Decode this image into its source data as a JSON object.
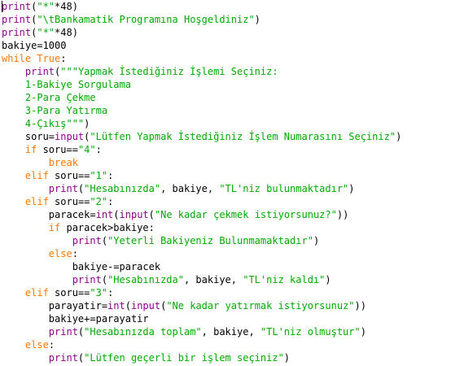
{
  "editor": {
    "colors": {
      "background": "#ffffff",
      "keyword": "#ff7700",
      "builtin": "#900090",
      "string": "#00aa00",
      "text": "#000000"
    },
    "lines": [
      [
        [
          "bi",
          "print"
        ],
        [
          "t",
          "("
        ],
        [
          "s",
          "\"*\""
        ],
        [
          "t",
          "*48)"
        ]
      ],
      [
        [
          "bi",
          "print"
        ],
        [
          "t",
          "("
        ],
        [
          "s",
          "\"\\tBankamatik Programına Hoşgeldiniz\""
        ],
        [
          "t",
          ")"
        ]
      ],
      [
        [
          "bi",
          "print"
        ],
        [
          "t",
          "("
        ],
        [
          "s",
          "\"*\""
        ],
        [
          "t",
          "*48)"
        ]
      ],
      [
        [
          "t",
          "bakiye=1000"
        ]
      ],
      [
        [
          "kw",
          "while"
        ],
        [
          "t",
          " "
        ],
        [
          "kw",
          "True"
        ],
        [
          "t",
          ":"
        ]
      ],
      [
        [
          "t",
          "    "
        ],
        [
          "bi",
          "print"
        ],
        [
          "t",
          "("
        ],
        [
          "s",
          "\"\"\"Yapmak İstediğiniz İşlemi Seçiniz:"
        ]
      ],
      [
        [
          "s",
          "    1-Bakiye Sorgulama"
        ]
      ],
      [
        [
          "s",
          "    2-Para Çekme"
        ]
      ],
      [
        [
          "s",
          "    3-Para Yatırma"
        ]
      ],
      [
        [
          "s",
          "    4-Çıkış\"\"\""
        ],
        [
          "t",
          ")"
        ]
      ],
      [
        [
          "t",
          "    soru="
        ],
        [
          "bi",
          "input"
        ],
        [
          "t",
          "("
        ],
        [
          "s",
          "\"Lütfen Yapmak İstediğiniz İşlem Numarasını Seçiniz\""
        ],
        [
          "t",
          ")"
        ]
      ],
      [
        [
          "t",
          "    "
        ],
        [
          "kw",
          "if"
        ],
        [
          "t",
          " soru=="
        ],
        [
          "s",
          "\"4\""
        ],
        [
          "t",
          ":"
        ]
      ],
      [
        [
          "t",
          "        "
        ],
        [
          "kw",
          "break"
        ]
      ],
      [
        [
          "t",
          "    "
        ],
        [
          "kw",
          "elif"
        ],
        [
          "t",
          " soru=="
        ],
        [
          "s",
          "\"1\""
        ],
        [
          "t",
          ":"
        ]
      ],
      [
        [
          "t",
          "        "
        ],
        [
          "bi",
          "print"
        ],
        [
          "t",
          "("
        ],
        [
          "s",
          "\"Hesabınızda\""
        ],
        [
          "t",
          ", bakiye, "
        ],
        [
          "s",
          "\"TL'niz bulunmaktadır\""
        ],
        [
          "t",
          ")"
        ]
      ],
      [
        [
          "t",
          "    "
        ],
        [
          "kw",
          "elif"
        ],
        [
          "t",
          " soru=="
        ],
        [
          "s",
          "\"2\""
        ],
        [
          "t",
          ":"
        ]
      ],
      [
        [
          "t",
          "        paracek="
        ],
        [
          "bi",
          "int"
        ],
        [
          "t",
          "("
        ],
        [
          "bi",
          "input"
        ],
        [
          "t",
          "("
        ],
        [
          "s",
          "\"Ne kadar çekmek istiyorsunuz?\""
        ],
        [
          "t",
          "))"
        ]
      ],
      [
        [
          "t",
          "        "
        ],
        [
          "kw",
          "if"
        ],
        [
          "t",
          " paracek>bakiye:"
        ]
      ],
      [
        [
          "t",
          "            "
        ],
        [
          "bi",
          "print"
        ],
        [
          "t",
          "("
        ],
        [
          "s",
          "\"Yeterli Bakiyeniz Bulunmamaktadır\""
        ],
        [
          "t",
          ")"
        ]
      ],
      [
        [
          "t",
          "        "
        ],
        [
          "kw",
          "else"
        ],
        [
          "t",
          ":"
        ]
      ],
      [
        [
          "t",
          "            bakiye-=paracek"
        ]
      ],
      [
        [
          "t",
          "            "
        ],
        [
          "bi",
          "print"
        ],
        [
          "t",
          "("
        ],
        [
          "s",
          "\"Hesabınızda\""
        ],
        [
          "t",
          ", bakiye, "
        ],
        [
          "s",
          "\"TL'niz kaldı\""
        ],
        [
          "t",
          ")"
        ]
      ],
      [
        [
          "t",
          "    "
        ],
        [
          "kw",
          "elif"
        ],
        [
          "t",
          " soru=="
        ],
        [
          "s",
          "\"3\""
        ],
        [
          "t",
          ":"
        ]
      ],
      [
        [
          "t",
          "        parayatir="
        ],
        [
          "bi",
          "int"
        ],
        [
          "t",
          "("
        ],
        [
          "bi",
          "input"
        ],
        [
          "t",
          "("
        ],
        [
          "s",
          "\"Ne kadar yatırmak istiyorsunuz\""
        ],
        [
          "t",
          "))"
        ]
      ],
      [
        [
          "t",
          "        bakiye+=parayatir"
        ]
      ],
      [
        [
          "t",
          "        "
        ],
        [
          "bi",
          "print"
        ],
        [
          "t",
          "("
        ],
        [
          "s",
          "\"Hesabınızda toplam\""
        ],
        [
          "t",
          ", bakiye, "
        ],
        [
          "s",
          "\"TL'niz olmuştur\""
        ],
        [
          "t",
          ")"
        ]
      ],
      [
        [
          "t",
          "    "
        ],
        [
          "kw",
          "else"
        ],
        [
          "t",
          ":"
        ]
      ],
      [
        [
          "t",
          "        "
        ],
        [
          "bi",
          "print"
        ],
        [
          "t",
          "("
        ],
        [
          "s",
          "\"Lütfen geçerli bir işlem seçiniz\""
        ],
        [
          "t",
          ")"
        ]
      ]
    ]
  }
}
